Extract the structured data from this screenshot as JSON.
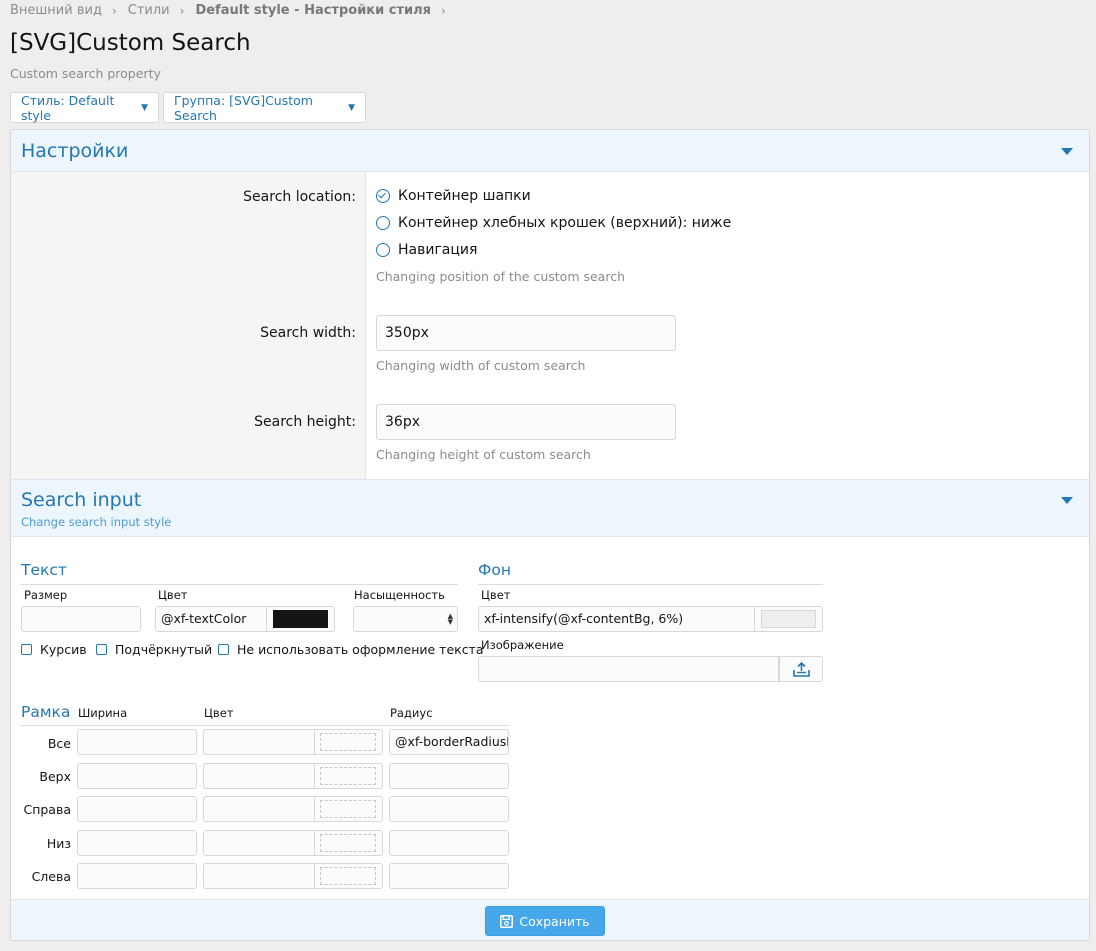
{
  "breadcrumb": [
    "Внешний вид",
    "Стили",
    "Default style - Настройки стиля"
  ],
  "page": {
    "title": "[SVG]Custom Search",
    "description": "Custom search property"
  },
  "menus": {
    "style_label": "Стиль: Default style",
    "group_label": "Группа: [SVG]Custom Search"
  },
  "settings": {
    "header": "Настройки",
    "search_location": {
      "label": "Search location:",
      "options": [
        "Контейнер шапки",
        "Контейнер хлебных крошек (верхний): ниже",
        "Навигация"
      ],
      "selected_index": 0,
      "explain": "Changing position of the custom search"
    },
    "search_width": {
      "label": "Search width:",
      "value": "350px",
      "explain": "Changing width of custom search"
    },
    "search_height": {
      "label": "Search height:",
      "value": "36px",
      "explain": "Changing height of custom search"
    }
  },
  "search_input": {
    "header": "Search input",
    "subheader": "Change search input style",
    "text": {
      "title": "Текст",
      "size_label": "Размер",
      "size_value": "",
      "color_label": "Цвет",
      "color_value": "@xf-textColor",
      "color_swatch": "#141414",
      "weight_label": "Насыщенность",
      "weight_value": "",
      "italic_label": "Курсив",
      "underline_label": "Подчёркнутый",
      "no_decoration_label": "Не использовать оформление текста"
    },
    "background": {
      "title": "Фон",
      "color_label": "Цвет",
      "color_value": "xf-intensify(@xf-contentBg, 6%)",
      "color_swatch": "#eeeeee",
      "image_label": "Изображение",
      "image_value": ""
    },
    "border": {
      "title": "Рамка",
      "width_label": "Ширина",
      "color_label": "Цвет",
      "radius_label": "Радиус",
      "rows": [
        {
          "label": "Все",
          "width": "",
          "color": "",
          "radius": "@xf-borderRadiusM"
        },
        {
          "label": "Верх",
          "width": "",
          "color": "",
          "radius": ""
        },
        {
          "label": "Справа",
          "width": "",
          "color": "",
          "radius": ""
        },
        {
          "label": "Низ",
          "width": "",
          "color": "",
          "radius": ""
        },
        {
          "label": "Слева",
          "width": "",
          "color": "",
          "radius": ""
        }
      ]
    }
  },
  "footer": {
    "save_label": "Сохранить"
  },
  "colors": {
    "accent": "#2577b1",
    "save_button": "#47a7eb",
    "header_bg": "#edf6fd"
  }
}
